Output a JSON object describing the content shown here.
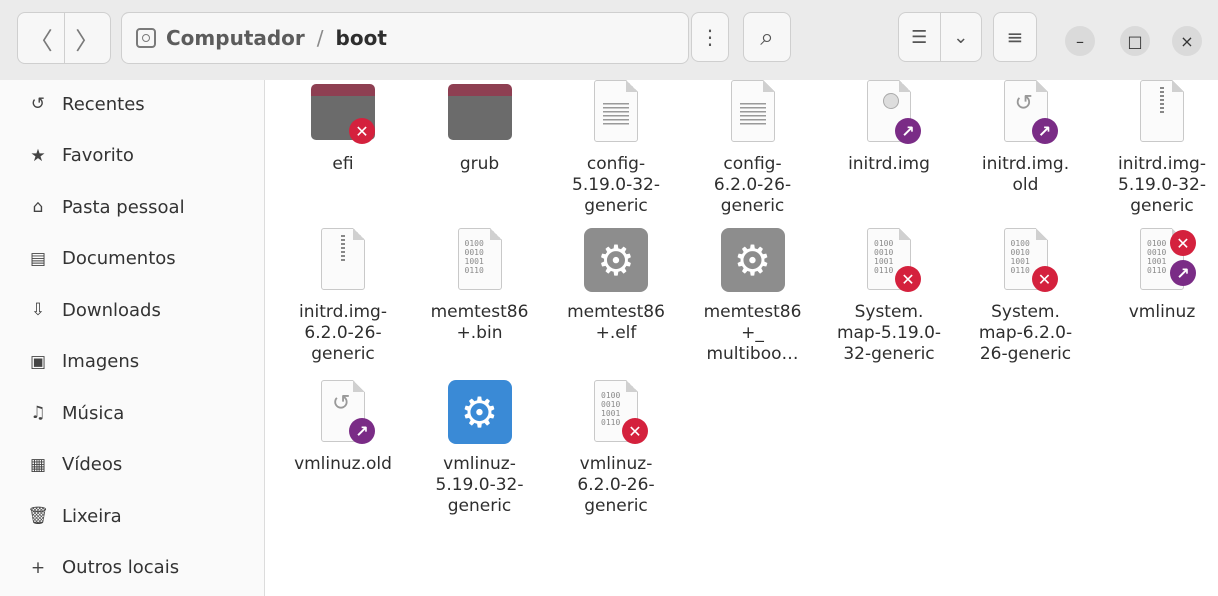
{
  "header": {
    "back_label": "〈",
    "forward_label": "〉",
    "path_root": "Computador",
    "path_separator": "/",
    "path_current": "boot",
    "menu_label": "⋮",
    "search_label": "⌕",
    "view_list_label": "☰",
    "view_dropdown_label": "⌄",
    "main_menu_label": "≡",
    "minimize_label": "–",
    "maximize_label": "□",
    "close_label": "×"
  },
  "sidebar": {
    "items": [
      {
        "label": "Recentes",
        "icon": "↺"
      },
      {
        "label": "Favorito",
        "icon": "★"
      },
      {
        "label": "Pasta pessoal",
        "icon": "⌂"
      },
      {
        "label": "Documentos",
        "icon": "▤"
      },
      {
        "label": "Downloads",
        "icon": "⇩"
      },
      {
        "label": "Imagens",
        "icon": "▣"
      },
      {
        "label": "Música",
        "icon": "♫"
      },
      {
        "label": "Vídeos",
        "icon": "▦"
      },
      {
        "label": "Lixeira",
        "icon": "🗑"
      },
      {
        "label": "Outros locais",
        "icon": "+"
      }
    ]
  },
  "files": [
    {
      "name": "efi",
      "type": "folder",
      "badge": "x"
    },
    {
      "name": "grub",
      "type": "folder"
    },
    {
      "name": "config-\n5.19.0-32-\ngeneric",
      "type": "text"
    },
    {
      "name": "config-\n6.2.0-26-\ngeneric",
      "type": "text"
    },
    {
      "name": "initrd.img",
      "type": "disc",
      "badge": "link"
    },
    {
      "name": "initrd.img.\nold",
      "type": "history",
      "badge": "link"
    },
    {
      "name": "initrd.img-\n5.19.0-32-\ngeneric",
      "type": "zip"
    },
    {
      "name": "initrd.img-\n6.2.0-26-\ngeneric",
      "type": "zip"
    },
    {
      "name": "memtest86\n+.bin",
      "type": "binary"
    },
    {
      "name": "memtest86\n+.elf",
      "type": "gear"
    },
    {
      "name": "memtest86\n+_\nmultiboo…",
      "type": "gear"
    },
    {
      "name": "System.\nmap-5.19.0-\n32-generic",
      "type": "binary",
      "badge": "x"
    },
    {
      "name": "System.\nmap-6.2.0-\n26-generic",
      "type": "binary",
      "badge": "x"
    },
    {
      "name": "vmlinuz",
      "type": "binary",
      "badge": "xlink"
    },
    {
      "name": "vmlinuz.old",
      "type": "history",
      "badge": "link"
    },
    {
      "name": "vmlinuz-\n5.19.0-32-\ngeneric",
      "type": "gearblue"
    },
    {
      "name": "vmlinuz-\n6.2.0-26-\ngeneric",
      "type": "binary",
      "badge": "x"
    }
  ],
  "binary_text": "0100\n0010\n1001\n0110",
  "colors": {
    "folder_tab": "#8e3f52",
    "badge_error": "#d4213d",
    "badge_link": "#7a2c86",
    "accent_blue": "#3a8ad6"
  }
}
